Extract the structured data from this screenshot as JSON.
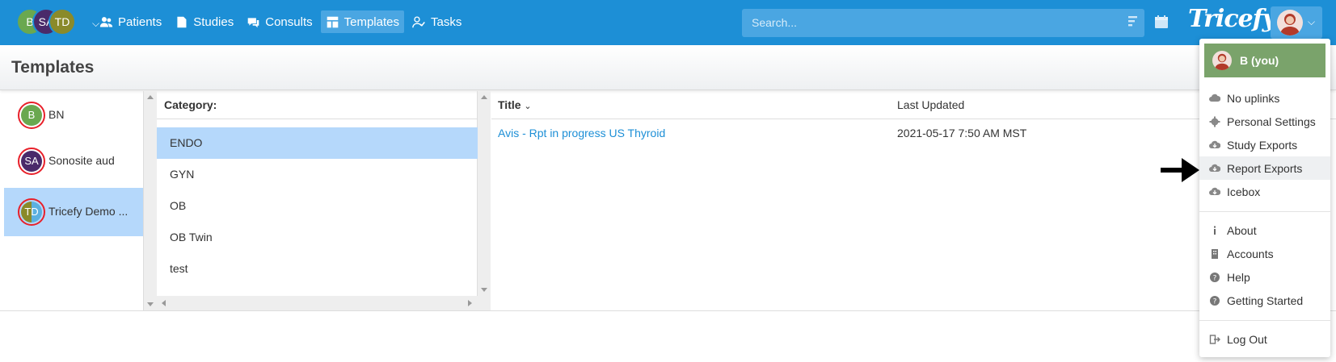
{
  "topbar": {
    "avatars": [
      {
        "initials": "B",
        "color": "#6aa84f"
      },
      {
        "initials": "SA",
        "color": "#4a2a6a"
      },
      {
        "initials": "TD",
        "color": "#8a8a2a"
      }
    ],
    "nav": [
      {
        "label": "Patients",
        "icon": "patients-icon",
        "active": false
      },
      {
        "label": "Studies",
        "icon": "studies-icon",
        "active": false
      },
      {
        "label": "Consults",
        "icon": "consults-icon",
        "active": false
      },
      {
        "label": "Templates",
        "icon": "templates-icon",
        "active": true
      },
      {
        "label": "Tasks",
        "icon": "tasks-icon",
        "active": false
      }
    ],
    "search_placeholder": "Search...",
    "logo": "Tricefy"
  },
  "header": {
    "title": "Templates"
  },
  "accounts": [
    {
      "initials": "B",
      "label": "BN",
      "color": "#6aa84f",
      "selected": false
    },
    {
      "initials": "SA",
      "label": "Sonosite aud",
      "color": "#4a2a6a",
      "selected": false
    },
    {
      "initials": "TD",
      "label": "Tricefy Demo ...",
      "color": "#8a8a2a",
      "selected": true
    }
  ],
  "categories": {
    "header": "Category:",
    "items": [
      {
        "label": "ENDO",
        "selected": true
      },
      {
        "label": "GYN",
        "selected": false
      },
      {
        "label": "OB",
        "selected": false
      },
      {
        "label": "OB Twin",
        "selected": false
      },
      {
        "label": "test",
        "selected": false
      }
    ]
  },
  "templates": {
    "columns": {
      "title": "Title",
      "last_updated": "Last Updated"
    },
    "rows": [
      {
        "title": "Avis - Rpt in progress US Thyroid",
        "last_updated": "2021-05-17 7:50 AM MST"
      }
    ]
  },
  "user_menu": {
    "user_label": "B (you)",
    "items": [
      {
        "label": "No uplinks",
        "icon": "cloud-icon"
      },
      {
        "label": "Personal Settings",
        "icon": "gear-icon"
      },
      {
        "label": "Study Exports",
        "icon": "cloud-download-icon"
      },
      {
        "label": "Report Exports",
        "icon": "cloud-download-icon",
        "highlighted": true
      },
      {
        "label": "Icebox",
        "icon": "cloud-download-icon"
      },
      {
        "label": "About",
        "icon": "info-icon"
      },
      {
        "label": "Accounts",
        "icon": "building-icon"
      },
      {
        "label": "Help",
        "icon": "question-icon"
      },
      {
        "label": "Getting Started",
        "icon": "question-icon"
      },
      {
        "label": "Log Out",
        "icon": "logout-icon"
      }
    ]
  },
  "colors": {
    "topbar": "#1d8fd6",
    "selection": "#b5d8fb",
    "link": "#1d8fd6",
    "menu_header": "#7aa36b"
  }
}
